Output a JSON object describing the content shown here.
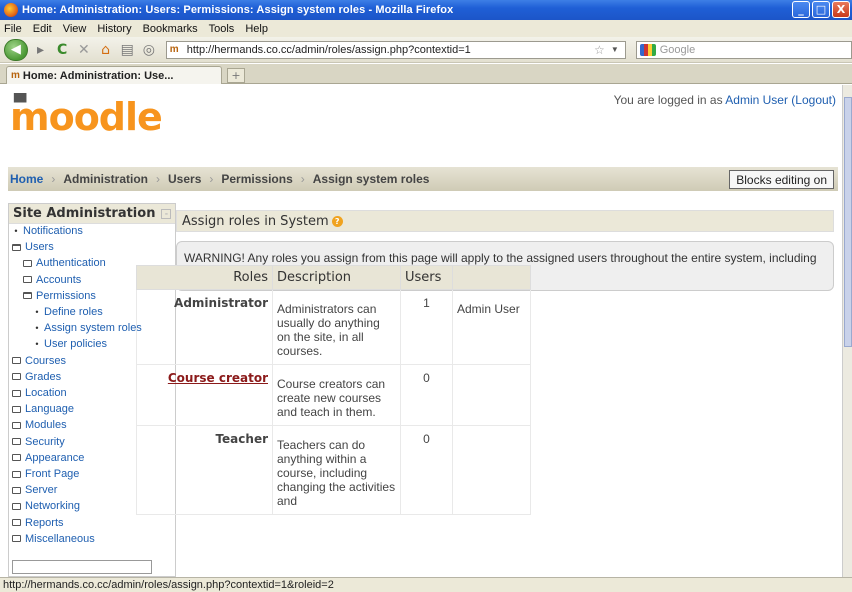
{
  "window": {
    "title": "Home: Administration: Users: Permissions: Assign system roles - Mozilla Firefox",
    "buttons": [
      "_",
      "□",
      "X"
    ]
  },
  "menubar": [
    "File",
    "Edit",
    "View",
    "History",
    "Bookmarks",
    "Tools",
    "Help"
  ],
  "toolbar": {
    "url": "http://hermands.co.cc/admin/roles/assign.php?contextid=1",
    "search_placeholder": "Google"
  },
  "tab": {
    "label": "Home: Administration: Use..."
  },
  "header": {
    "logo": "moodle",
    "login_prefix": "You are logged in as ",
    "login_user": "Admin User",
    "logout": "(Logout)"
  },
  "breadcrumb": [
    "Home",
    "Administration",
    "Users",
    "Permissions",
    "Assign system roles"
  ],
  "blocks_button": "Blocks editing on",
  "sidebar": {
    "title": "Site Administration",
    "items": [
      {
        "label": "Notifications",
        "level": 0,
        "kind": "bullet"
      },
      {
        "label": "Users",
        "level": 0,
        "kind": "folder-open"
      },
      {
        "label": "Authentication",
        "level": 1,
        "kind": "folder"
      },
      {
        "label": "Accounts",
        "level": 1,
        "kind": "folder"
      },
      {
        "label": "Permissions",
        "level": 1,
        "kind": "folder-open"
      },
      {
        "label": "Define roles",
        "level": 2,
        "kind": "bullet"
      },
      {
        "label": "Assign system roles",
        "level": 2,
        "kind": "bullet"
      },
      {
        "label": "User policies",
        "level": 2,
        "kind": "bullet"
      },
      {
        "label": "Courses",
        "level": 0,
        "kind": "folder"
      },
      {
        "label": "Grades",
        "level": 0,
        "kind": "folder"
      },
      {
        "label": "Location",
        "level": 0,
        "kind": "folder"
      },
      {
        "label": "Language",
        "level": 0,
        "kind": "folder"
      },
      {
        "label": "Modules",
        "level": 0,
        "kind": "folder"
      },
      {
        "label": "Security",
        "level": 0,
        "kind": "folder"
      },
      {
        "label": "Appearance",
        "level": 0,
        "kind": "folder"
      },
      {
        "label": "Front Page",
        "level": 0,
        "kind": "folder"
      },
      {
        "label": "Server",
        "level": 0,
        "kind": "folder"
      },
      {
        "label": "Networking",
        "level": 0,
        "kind": "folder"
      },
      {
        "label": "Reports",
        "level": 0,
        "kind": "folder"
      },
      {
        "label": "Miscellaneous",
        "level": 0,
        "kind": "folder"
      }
    ]
  },
  "main": {
    "heading": "Assign roles in System",
    "warning": "WARNING! Any roles you assign from this page will apply to the assigned users throughout the entire system, including the front page and all the courses.",
    "table": {
      "headers": [
        "Roles",
        "Description",
        "Users",
        ""
      ],
      "rows": [
        {
          "role": "Administrator",
          "description": "Administrators can usually do anything on the site, in all courses.",
          "users": "1",
          "names": "Admin User"
        },
        {
          "role": "Course creator",
          "description": "Course creators can create new courses and teach in them.",
          "users": "0",
          "names": ""
        },
        {
          "role": "Teacher",
          "description": "Teachers can do anything within a course, including changing the activities and",
          "users": "0",
          "names": ""
        }
      ]
    }
  },
  "statusbar": "http://hermands.co.cc/admin/roles/assign.php?contextid=1&roleid=2"
}
